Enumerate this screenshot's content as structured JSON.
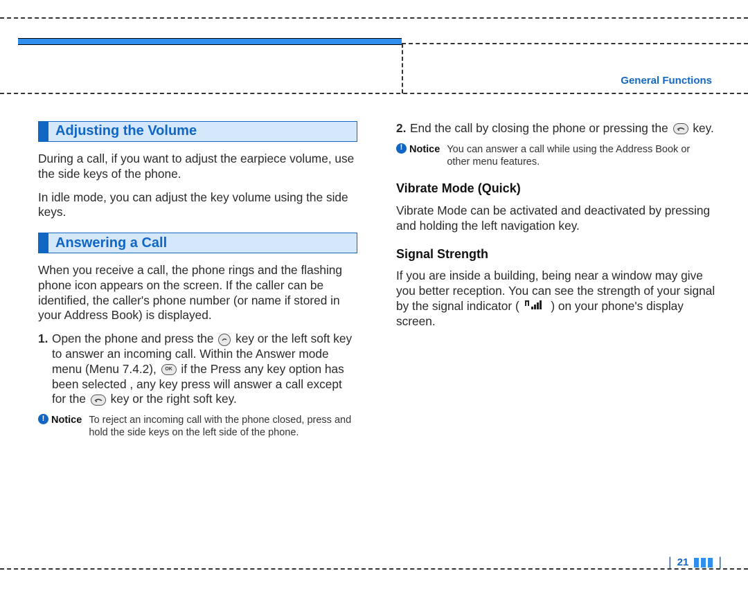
{
  "header": {
    "section_label": "General Functions"
  },
  "left_column": {
    "heading1": "Adjusting the Volume",
    "para1": "During a call, if you want to adjust the earpiece volume, use the side keys of the phone.",
    "para2": "In idle mode, you can adjust the key volume using the side keys.",
    "heading2": "Answering a Call",
    "para3": "When you receive a call, the phone rings and the flashing phone icon appears on the screen. If the caller can be identified, the caller's phone number (or name if stored in your Address Book) is displayed.",
    "step1_num": "1.",
    "step1_a": "Open the phone and press the ",
    "step1_b": " key or the left soft key to answer an incoming call. Within the Answer mode menu (Menu 7.4.2), ",
    "step1_c": " if the Press any key option has been selected , any key press will answer a call except for the ",
    "step1_d": " key or the right soft key.",
    "notice_label": "Notice",
    "notice_text": "To reject an incoming call with the phone closed, press and hold the side keys on the left side of the phone."
  },
  "right_column": {
    "step2_num": "2.",
    "step2_a": "End the call by closing the phone or pressing the ",
    "step2_b": " key.",
    "notice_label": "Notice",
    "notice_text": "You can answer a call while using the Address Book or other menu features.",
    "sub1": "Vibrate Mode (Quick)",
    "sub1_para": "Vibrate Mode can be activated and deactivated by pressing and holding the left navigation key.",
    "sub2": "Signal Strength",
    "sub2_a": "If you are inside a building, being near a window may give you better reception. You can see the strength of your signal by the signal indicator ( ",
    "sub2_b": " ) on your phone's display screen."
  },
  "footer": {
    "page_number": "21"
  },
  "icons": {
    "send_key": "↷",
    "ok_key": "OK",
    "end_key": "⏚",
    "signal": "📶"
  }
}
